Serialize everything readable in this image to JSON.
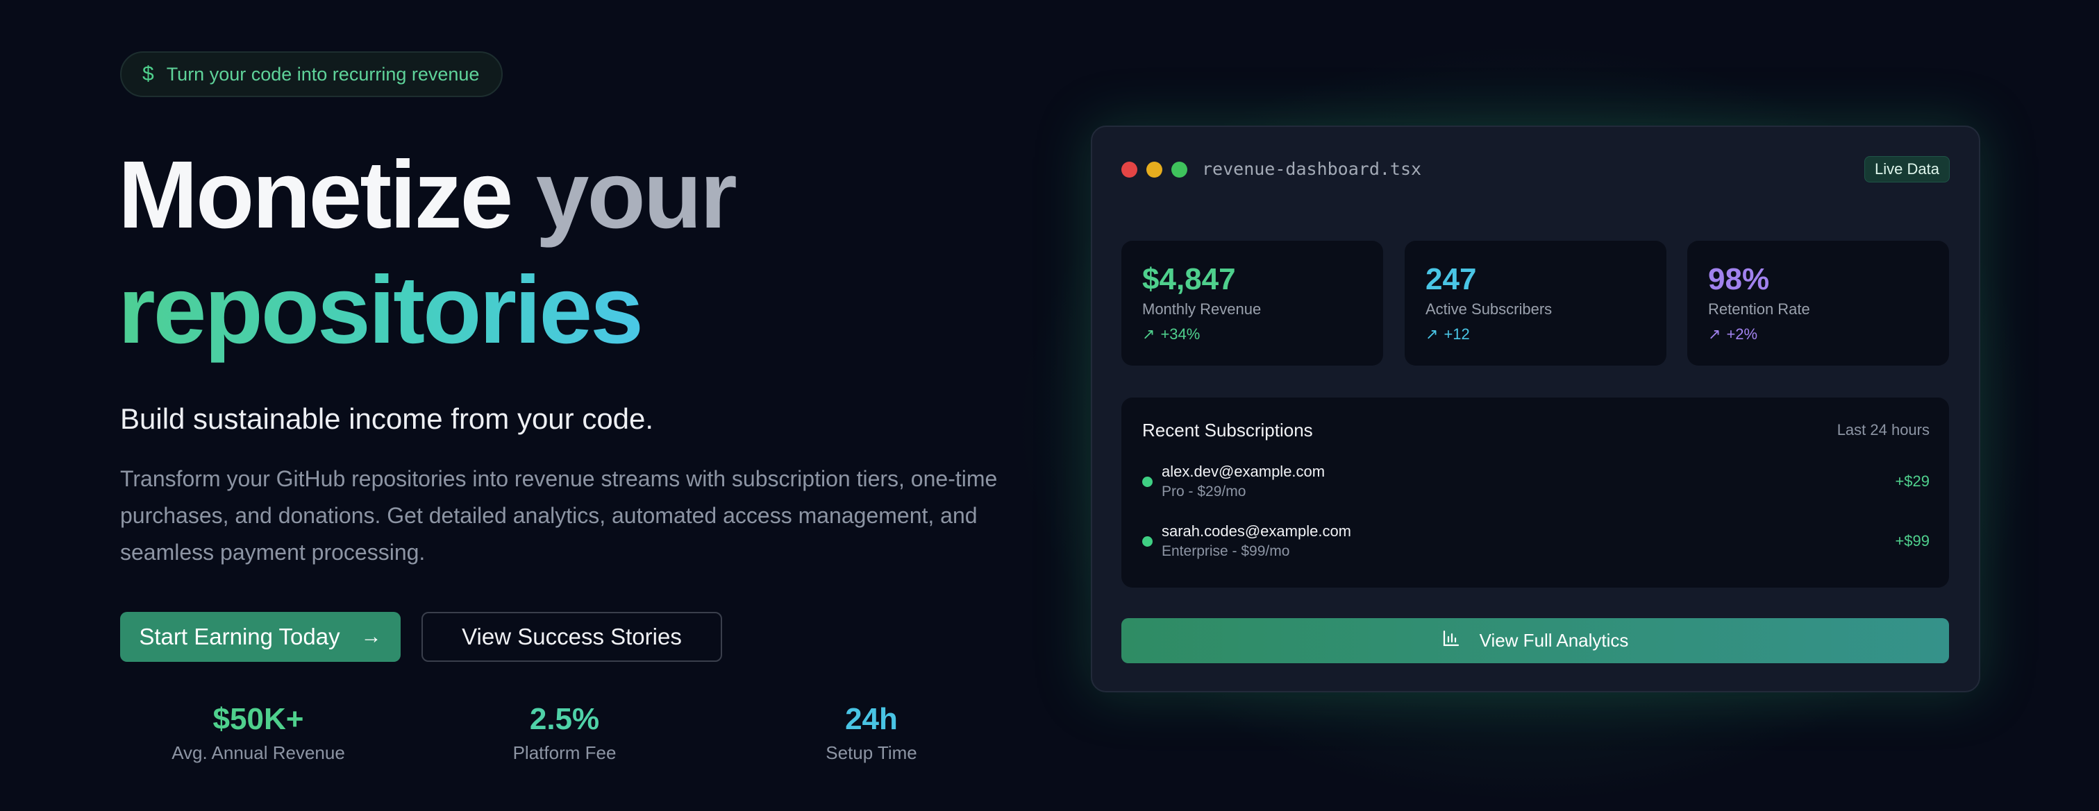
{
  "hero": {
    "badge_icon": "dollar-icon",
    "badge_text": "Turn your code into recurring revenue",
    "headline_word1": "Monetize",
    "headline_word2": "your",
    "headline_word3": "repositories",
    "subhead": "Build sustainable income from your code.",
    "description": "Transform your GitHub repositories into revenue streams with subscription tiers, one-time purchases, and donations. Get detailed analytics, automated access management, and seamless payment processing.",
    "primary_button": "Start Earning Today",
    "primary_button_icon": "arrow-right-icon",
    "secondary_button": "View Success Stories",
    "stats": [
      {
        "value": "$50K+",
        "label": "Avg. Annual Revenue"
      },
      {
        "value": "2.5%",
        "label": "Platform Fee"
      },
      {
        "value": "24h",
        "label": "Setup Time"
      }
    ]
  },
  "dashboard": {
    "filename": "revenue-dashboard.tsx",
    "live_badge": "Live Data",
    "metrics": [
      {
        "value": "$4,847",
        "label": "Monthly Revenue",
        "change": "+34%",
        "color": "#4fd08d"
      },
      {
        "value": "247",
        "label": "Active Subscribers",
        "change": "+12",
        "color": "#4ac6e6"
      },
      {
        "value": "98%",
        "label": "Retention Rate",
        "change": "+2%",
        "color": "#a182ee"
      }
    ],
    "recent": {
      "title": "Recent Subscriptions",
      "period": "Last 24 hours",
      "items": [
        {
          "email": "alex.dev@example.com",
          "plan": "Pro - $29/mo",
          "amount": "+$29"
        },
        {
          "email": "sarah.codes@example.com",
          "plan": "Enterprise - $99/mo",
          "amount": "+$99"
        }
      ]
    },
    "analytics_button": "View Full Analytics",
    "analytics_icon": "bar-chart-icon"
  },
  "colors": {
    "background": "#070b18",
    "accent_green": "#4fd08d",
    "accent_cyan": "#4ac6e6",
    "accent_purple": "#a182ee",
    "primary_button": "#2f8c6b"
  }
}
